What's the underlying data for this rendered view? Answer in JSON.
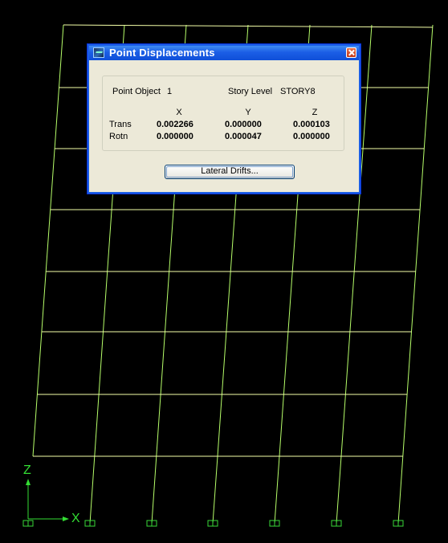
{
  "dialog": {
    "title": "Point Displacements",
    "point_object_label": "Point Object",
    "point_object_value": "1",
    "story_level_label": "Story Level",
    "story_level_value": "STORY8",
    "columns": [
      "X",
      "Y",
      "Z"
    ],
    "rows": [
      {
        "label": "Trans",
        "values": [
          "0.002266",
          "0.000000",
          "0.000103"
        ]
      },
      {
        "label": "Rotn",
        "values": [
          "0.000000",
          "0.000047",
          "0.000000"
        ]
      }
    ],
    "drifts_button_label": "Lateral Drifts..."
  },
  "view": {
    "axis_x_label": "X",
    "axis_z_label": "Z",
    "frame_color": "#b7ff6a",
    "floor_color": "#f4ffa8",
    "axis_color": "#33dd33",
    "support_color": "#39d839",
    "stories": 8,
    "bays": 6
  }
}
